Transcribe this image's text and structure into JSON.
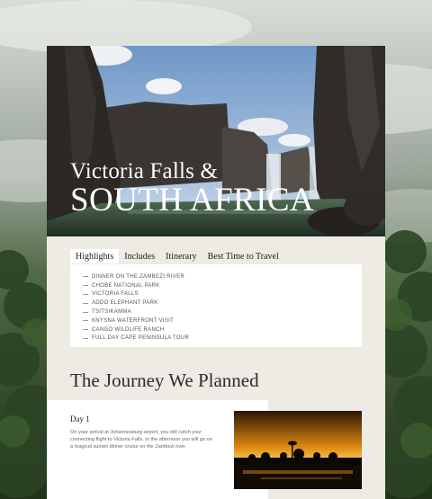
{
  "hero": {
    "title_line1": "Victoria Falls &",
    "title_line2": "SOUTH AFRICA"
  },
  "tabs": [
    {
      "label": "Highlights",
      "active": true
    },
    {
      "label": "Includes",
      "active": false
    },
    {
      "label": "Itinerary",
      "active": false
    },
    {
      "label": "Best Time to Travel",
      "active": false
    }
  ],
  "highlights": [
    "DINNER ON THE ZAMBEZI RIVER",
    "CHOBE NATIONAL PARK",
    "VICTORIA FALLS",
    "ADDO ELEPHANT PARK",
    "TSITSIKAMMA",
    "KNYSNA WATERFRONT VISIT",
    "CANGO WILDLIFE RANCH",
    "FULL DAY CAPE PENINSULA TOUR"
  ],
  "journey": {
    "title": "The Journey We Planned",
    "day_title": "Day 1",
    "day_text": "On your arrival at Johannesburg airport, you will catch your connecting flight to Victoria Falls. In the afternoon you will go on a magical sunset dinner cruise on the Zambezi river."
  },
  "colors": {
    "card_bg": "#eeeae4",
    "panel_bg": "#ffffff",
    "text_dark": "#222222"
  }
}
